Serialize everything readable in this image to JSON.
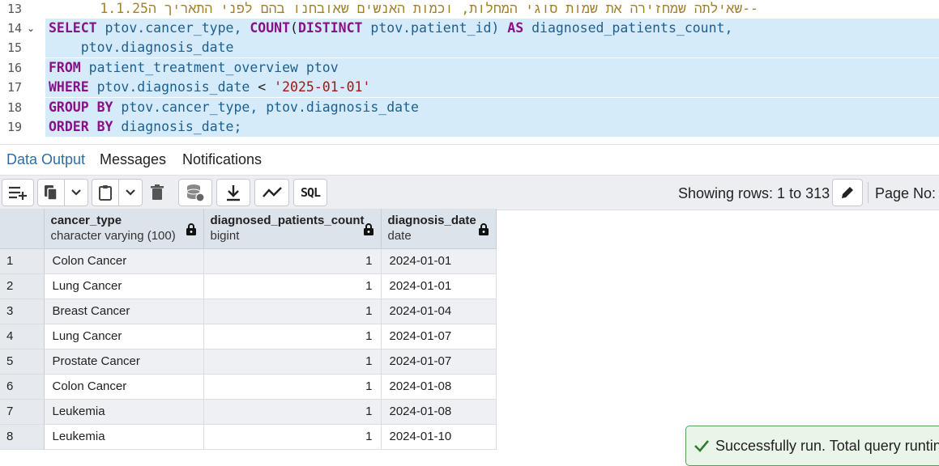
{
  "editor": {
    "comment": "--שאילתה שמחזירה את שמות סוגי המחלות, וכמות האנשים שאובחנו בהם לפני התאריך ה1.1.25",
    "line_numbers": [
      "13",
      "14",
      "15",
      "16",
      "17",
      "18",
      "19"
    ],
    "lines": {
      "l14": {
        "kw1": "SELECT",
        "t1": " ptov.cancer_type, ",
        "fn": "COUNT",
        "p1": "(",
        "kw2": "DISTINCT",
        "t2": " ptov.patient_id) ",
        "kw3": "AS",
        "t3": " diagnosed_patients_count,"
      },
      "l15": {
        "t1": "    ptov.diagnosis_date"
      },
      "l16": {
        "kw1": "FROM",
        "t1": " patient_treatment_overview ptov"
      },
      "l17": {
        "kw1": "WHERE",
        "t1": " ptov.diagnosis_date ",
        "op": "<",
        "t2": " ",
        "str": "'2025-01-01'"
      },
      "l18": {
        "kw1": "GROUP BY",
        "t1": " ptov.cancer_type, ptov.diagnosis_date"
      },
      "l19": {
        "kw1": "ORDER BY",
        "t1": " diagnosis_date;"
      }
    }
  },
  "tabs": [
    "Data Output",
    "Messages",
    "Notifications"
  ],
  "toolbar": {
    "icons": [
      "add-row-icon",
      "copy-icon",
      "chevron-down-icon",
      "paste-icon",
      "chevron-down-icon",
      "delete-icon",
      "save-data-icon",
      "download-icon",
      "graph-icon",
      "sql-icon"
    ],
    "sql_label": "SQL",
    "showing": "Showing rows: 1 to 313",
    "page_no_label": "Page No:"
  },
  "grid": {
    "columns": [
      {
        "name": "cancer_type",
        "type": "character varying (100)"
      },
      {
        "name": "diagnosed_patients_count",
        "type": "bigint"
      },
      {
        "name": "diagnosis_date",
        "type": "date"
      }
    ],
    "rows": [
      {
        "n": "1",
        "cancer_type": "Colon Cancer",
        "count": "1",
        "date": "2024-01-01"
      },
      {
        "n": "2",
        "cancer_type": "Lung Cancer",
        "count": "1",
        "date": "2024-01-01"
      },
      {
        "n": "3",
        "cancer_type": "Breast Cancer",
        "count": "1",
        "date": "2024-01-04"
      },
      {
        "n": "4",
        "cancer_type": "Lung Cancer",
        "count": "1",
        "date": "2024-01-07"
      },
      {
        "n": "5",
        "cancer_type": "Prostate Cancer",
        "count": "1",
        "date": "2024-01-07"
      },
      {
        "n": "6",
        "cancer_type": "Colon Cancer",
        "count": "1",
        "date": "2024-01-08"
      },
      {
        "n": "7",
        "cancer_type": "Leukemia",
        "count": "1",
        "date": "2024-01-08"
      },
      {
        "n": "8",
        "cancer_type": "Leukemia",
        "count": "1",
        "date": "2024-01-10"
      }
    ]
  },
  "toast": {
    "text": "Successfully run. Total query runtin"
  },
  "colors": {
    "accent": "#2c6ea9",
    "selection": "#d6ebf9",
    "success": "#5a9d5a"
  }
}
